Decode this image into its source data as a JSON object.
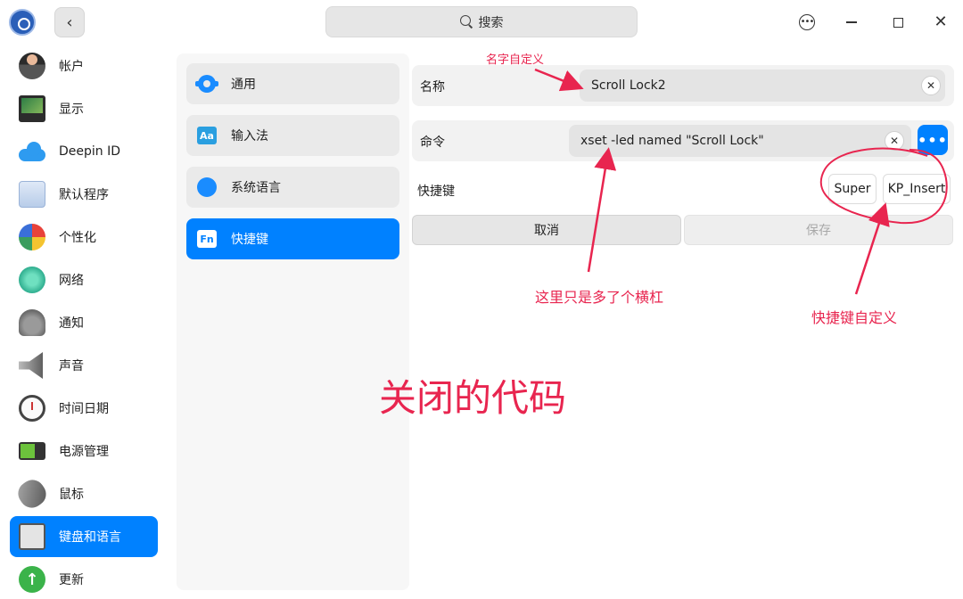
{
  "titlebar": {
    "search_label": "搜索"
  },
  "sidebar": {
    "items": [
      {
        "label": "帐户",
        "icon": "account-icon"
      },
      {
        "label": "显示",
        "icon": "display-icon"
      },
      {
        "label": "Deepin ID",
        "icon": "cloud-icon"
      },
      {
        "label": "默认程序",
        "icon": "default-apps-icon"
      },
      {
        "label": "个性化",
        "icon": "personalization-icon"
      },
      {
        "label": "网络",
        "icon": "network-icon"
      },
      {
        "label": "通知",
        "icon": "bell-icon"
      },
      {
        "label": "声音",
        "icon": "speaker-icon"
      },
      {
        "label": "时间日期",
        "icon": "clock-icon"
      },
      {
        "label": "电源管理",
        "icon": "battery-icon"
      },
      {
        "label": "鼠标",
        "icon": "mouse-icon"
      },
      {
        "label": "键盘和语言",
        "icon": "keyboard-icon",
        "active": true
      },
      {
        "label": "更新",
        "icon": "update-arrow-icon"
      }
    ]
  },
  "subnav": {
    "items": [
      {
        "label": "通用",
        "icon": "gear-icon"
      },
      {
        "label": "输入法",
        "icon": "input-method-icon"
      },
      {
        "label": "系统语言",
        "icon": "globe-icon"
      },
      {
        "label": "快捷键",
        "icon": "fn-key-icon",
        "active": true
      }
    ]
  },
  "form": {
    "name_label": "名称",
    "name_value": "Scroll Lock2",
    "command_label": "命令",
    "command_value": "xset -led named \"Scroll Lock\"",
    "shortcut_label": "快捷键",
    "shortcut_keys": [
      "Super",
      "KP_Insert"
    ],
    "cancel_label": "取消",
    "save_label": "保存"
  },
  "annotations": {
    "name_note": "名字自定义",
    "command_note": "这里只是多了个横杠",
    "shortcut_note": "快捷键自定义",
    "main_note": "关闭的代码"
  },
  "colors": {
    "accent": "#0081ff",
    "annotation": "#e8254f"
  }
}
